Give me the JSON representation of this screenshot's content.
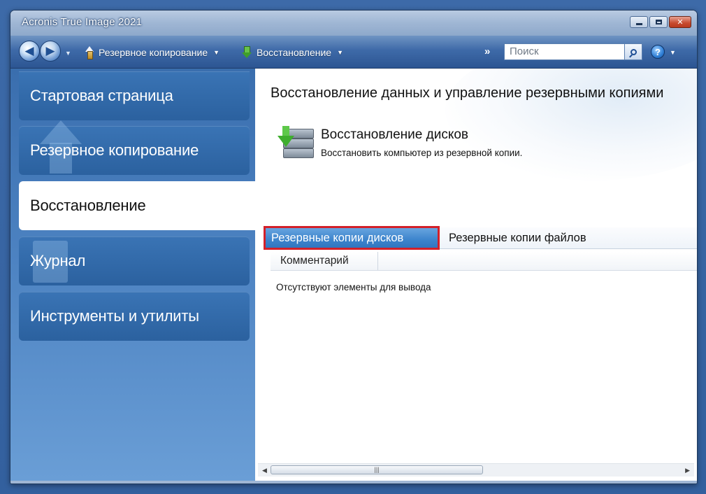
{
  "window": {
    "title": "Acronis True Image 2021"
  },
  "toolbar": {
    "backup_label": "Резервное копирование",
    "restore_label": "Восстановление",
    "overflow_label": "»",
    "search_placeholder": "Поиск",
    "help_label": "?"
  },
  "sidebar": {
    "items": [
      {
        "label": "Стартовая страница"
      },
      {
        "label": "Резервное копирование"
      },
      {
        "label": "Восстановление"
      },
      {
        "label": "Журнал"
      },
      {
        "label": "Инструменты и утилиты"
      }
    ],
    "active_index": 2
  },
  "main": {
    "title": "Восстановление данных и управление резервными копиями",
    "task": {
      "title": "Восстановление дисков",
      "description": "Восстановить компьютер из резервной копии."
    },
    "tabs": [
      {
        "label": "Резервные копии дисков"
      },
      {
        "label": "Резервные копии файлов"
      }
    ],
    "active_tab": 0,
    "columns": [
      {
        "label": "Комментарий"
      }
    ],
    "empty_message": "Отсутствуют элементы для вывода"
  },
  "colors": {
    "accent": "#3c84cc",
    "highlight_border": "#d32029",
    "sidebar": "#3a6eae"
  }
}
